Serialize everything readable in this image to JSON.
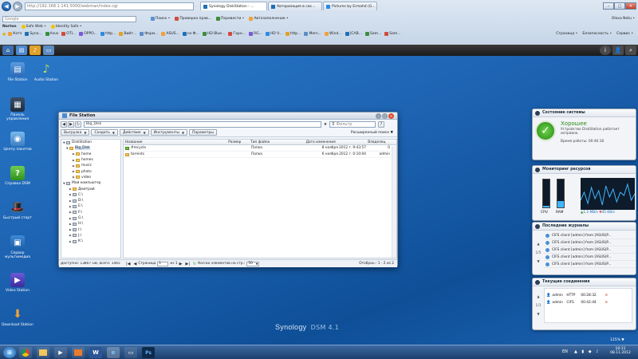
{
  "browser": {
    "address": "http://192.168.1.141:5000/webman/index.cgi",
    "search_placeholder": "Google",
    "tabs": [
      {
        "label": "Synology DiskStation - ...",
        "active": true
      },
      {
        "label": "Авторизация в сис...",
        "active": false
      },
      {
        "label": "Pictures by Ermahd (G...",
        "active": false
      }
    ],
    "search_button": "Поиск •",
    "toolbar_row": [
      "Поиск •",
      "Проверка прав...",
      "Перевести •",
      "Автозаполнение •"
    ],
    "norton_label": "Norton",
    "norton_items": [
      "Safe Web •",
      "Identity Safe •"
    ],
    "favorites": [
      "Котэ",
      "Syno...",
      "Asus",
      "OTI...",
      "OPPO...",
      "http...",
      "Вийт...",
      "Форм...",
      "ASUS...",
      "нэ Ф...",
      "HD Blue...",
      "Гарн...",
      "RG...",
      "HD V...",
      "http...",
      "Mern...",
      "Wind...",
      "[CAB...",
      "Sam...",
      "Sam..."
    ],
    "right_tools": [
      "Страница •",
      "Безопасность •",
      "Сервис •"
    ],
    "user_text": "Olexa Netu •",
    "zoom": "125%"
  },
  "dsm_bar": {
    "icons": [
      "home-icon",
      "file-station-icon",
      "audio-station-icon",
      "window-icon"
    ]
  },
  "desktop_icons": [
    {
      "label": "File Station",
      "icon": "file-station-icon"
    },
    {
      "label": "Audio Station",
      "icon": "audio-station-icon"
    },
    {
      "label": "Панель управления",
      "icon": "control-panel-icon"
    },
    {
      "label": "Центр пакетов",
      "icon": "package-center-icon"
    },
    {
      "label": "Справка DSM",
      "icon": "help-icon"
    },
    {
      "label": "Быстрый старт",
      "icon": "quick-start-icon"
    },
    {
      "label": "Сервер мультимедиа",
      "icon": "media-server-icon"
    },
    {
      "label": "Video Station",
      "icon": "video-station-icon"
    },
    {
      "label": "Download Station",
      "icon": "download-station-icon"
    }
  ],
  "file_station": {
    "title": "File Station",
    "path": "Big_Disk",
    "filter_placeholder": "Фильтр",
    "toolbar": [
      "Выгрузка",
      "Создать",
      "Действие",
      "Инструменты",
      "Параметры"
    ],
    "advanced_search": "Расширенный поиск",
    "tree": {
      "root": "DiskStation",
      "share": "Big_Disk",
      "folders": [
        "home",
        "homes",
        "music",
        "photo",
        "video"
      ],
      "computer": "Мой компьютер",
      "computer_children": [
        "Дмитрий",
        "C:\\",
        "D:\\",
        "E:\\",
        "F:\\",
        "G:\\",
        "H:\\",
        "I:\\",
        "J:\\",
        "K:\\"
      ]
    },
    "columns": [
      "Название",
      "Размер",
      "Тип файла",
      "Дата изменения",
      "Владелец"
    ],
    "files": [
      {
        "name": "#recycle",
        "size": "",
        "type": "Папка",
        "modified": "8 ноября 2012 г. 9:43:57",
        "owner": "0"
      },
      {
        "name": "torrents",
        "size": "",
        "type": "Папка",
        "modified": "6 ноября 2012 г. 0:10:04",
        "owner": "admin"
      }
    ],
    "status": {
      "available": "Доступно: 13807 GB, всего: 1465",
      "page_label": "Страница",
      "page": "1",
      "of": "из 1",
      "per_page_label": "Кол-во элементов на стр.:",
      "per_page": "50",
      "displayed": "Отобран.: 1 - 2 из 2"
    }
  },
  "widgets": {
    "system_state": {
      "title": "Состояние системы",
      "status": "Хорошее",
      "desc": "Устройство DiskStation работает исправно.",
      "uptime": "Время работы: 00:46:18"
    },
    "resources": {
      "title": "Мониторинг ресурсов",
      "cpu_label": "CPU",
      "ram_label": "RAM",
      "speed": "1.2 MB/s",
      "speed2": "45 KB/s",
      "cpu_percent": 6,
      "ram_percent": 22,
      "net_history": [
        30,
        55,
        20,
        70,
        35,
        60,
        15,
        75,
        40,
        65,
        25,
        55,
        45,
        80,
        30,
        50
      ]
    },
    "logs": {
      "title": "Последние журналы",
      "page": "1/5",
      "entries": [
        "CIFS client [admin] from [ASUS(P...",
        "CIFS client [admin] from [ASUS(P...",
        "CIFS client [admin] from [ASUS(P...",
        "CIFS client [admin] from [ASUS(P...",
        "CIFS client [admin] from [ASUS(P..."
      ]
    },
    "connections": {
      "title": "Текущие соединения",
      "page": "1/1",
      "rows": [
        {
          "user": "admin",
          "type": "HTTP",
          "time": "00:28:32"
        },
        {
          "user": "admin",
          "type": "CIFS",
          "time": "00:42:44"
        }
      ]
    }
  },
  "brand": {
    "name": "Synology",
    "product": "DSM 4.1"
  },
  "taskbar": {
    "lang": "EN",
    "time": "10:11",
    "date": "08.11.2012"
  }
}
